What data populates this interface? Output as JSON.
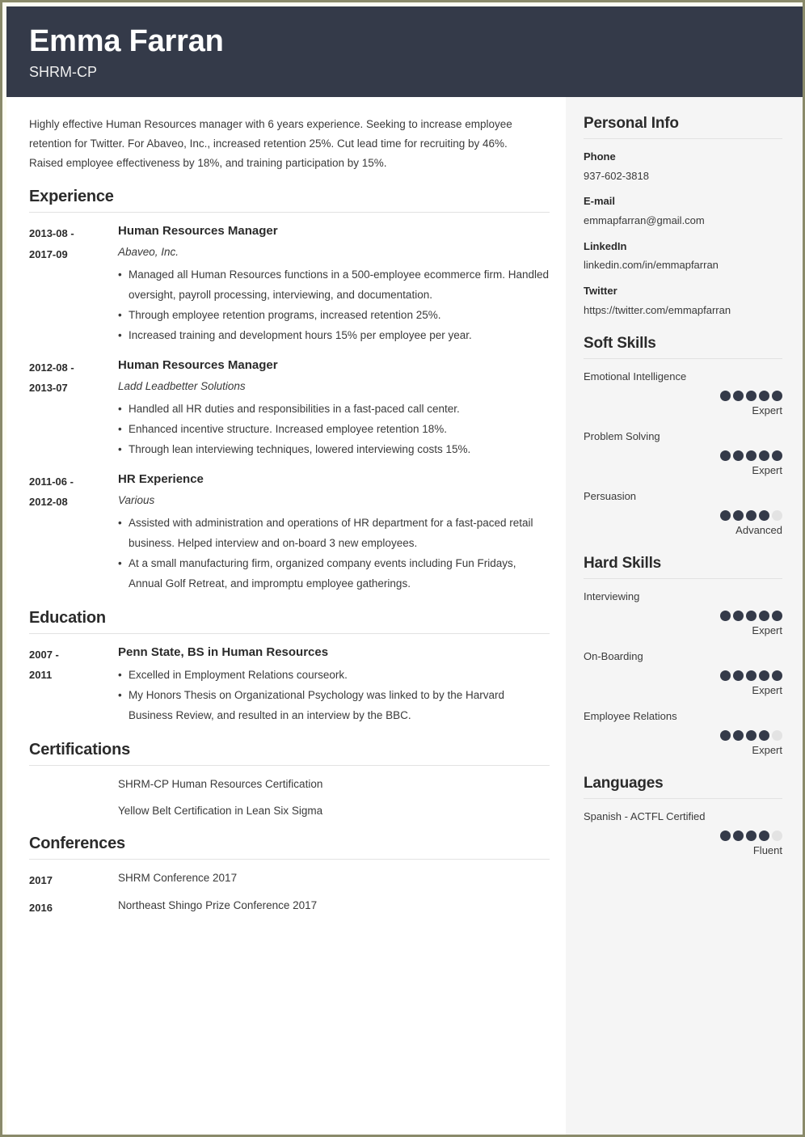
{
  "header": {
    "name": "Emma Farran",
    "credential": "SHRM-CP"
  },
  "main": {
    "summary": "Highly effective Human Resources manager with 6 years experience. Seeking to increase employee retention for Twitter. For Abaveo, Inc., increased retention 25%. Cut lead time for recruiting by 46%. Raised employee effectiveness by 18%, and training participation by 15%.",
    "sections": {
      "experience": {
        "title": "Experience",
        "entries": [
          {
            "date": "2013-08 - 2017-09",
            "date_line1": "2013-08 -",
            "date_line2": "2017-09",
            "title": "Human Resources Manager",
            "company": "Abaveo, Inc.",
            "bullets": [
              "Managed all Human Resources functions in a 500-employee ecommerce firm. Handled oversight, payroll processing, interviewing, and documentation.",
              "Through employee retention programs, increased retention 25%.",
              "Increased training and development hours 15% per employee per year."
            ]
          },
          {
            "date": "2012-08 - 2013-07",
            "date_line1": "2012-08 -",
            "date_line2": "2013-07",
            "title": "Human Resources Manager",
            "company": "Ladd Leadbetter Solutions",
            "bullets": [
              "Handled all HR duties and responsibilities in a fast-paced call center.",
              "Enhanced incentive structure. Increased employee retention 18%.",
              "Through lean interviewing techniques, lowered interviewing costs 15%."
            ]
          },
          {
            "date": "2011-06 - 2012-08",
            "date_line1": "2011-06 -",
            "date_line2": "2012-08",
            "title": "HR Experience",
            "company": "Various",
            "bullets": [
              "Assisted with administration and operations of HR department for a fast-paced retail business. Helped interview and on-board 3 new employees.",
              "At a small manufacturing firm, organized company events including Fun Fridays, Annual Golf Retreat, and impromptu employee gatherings."
            ]
          }
        ]
      },
      "education": {
        "title": "Education",
        "entries": [
          {
            "date": "2007 - 2011",
            "date_line1": "2007 -",
            "date_line2": "2011",
            "title": "Penn State, BS in Human Resources",
            "bullets": [
              "Excelled in Employment Relations courseork.",
              "My Honors Thesis on Organizational Psychology was linked to by the Harvard Business Review, and resulted in an interview by the BBC."
            ]
          }
        ]
      },
      "certifications": {
        "title": "Certifications",
        "items": [
          {
            "date": "",
            "text": "SHRM-CP Human Resources Certification"
          },
          {
            "date": "",
            "text": "Yellow Belt Certification in Lean Six Sigma"
          }
        ]
      },
      "conferences": {
        "title": "Conferences",
        "items": [
          {
            "date": "2017",
            "text": "SHRM Conference 2017"
          },
          {
            "date": "2016",
            "text": "Northeast Shingo Prize Conference 2017"
          }
        ]
      }
    }
  },
  "sidebar": {
    "personal_info": {
      "title": "Personal Info",
      "items": [
        {
          "label": "Phone",
          "value": "937-602-3818"
        },
        {
          "label": "E-mail",
          "value": "emmapfarran@gmail.com"
        },
        {
          "label": "LinkedIn",
          "value": "linkedin.com/in/emmapfarran"
        },
        {
          "label": "Twitter",
          "value": "https://twitter.com/emmapfarran"
        }
      ]
    },
    "soft_skills": {
      "title": "Soft Skills",
      "items": [
        {
          "name": "Emotional Intelligence",
          "rating": 5,
          "max": 5,
          "level": "Expert"
        },
        {
          "name": "Problem Solving",
          "rating": 5,
          "max": 5,
          "level": "Expert"
        },
        {
          "name": "Persuasion",
          "rating": 4,
          "max": 5,
          "level": "Advanced"
        }
      ]
    },
    "hard_skills": {
      "title": "Hard Skills",
      "items": [
        {
          "name": "Interviewing",
          "rating": 5,
          "max": 5,
          "level": "Expert"
        },
        {
          "name": "On-Boarding",
          "rating": 5,
          "max": 5,
          "level": "Expert"
        },
        {
          "name": "Employee Relations",
          "rating": 4,
          "max": 5,
          "level": "Expert"
        }
      ]
    },
    "languages": {
      "title": "Languages",
      "items": [
        {
          "name": "Spanish - ACTFL Certified",
          "rating": 4,
          "max": 5,
          "level": "Fluent"
        }
      ]
    }
  },
  "colors": {
    "header_bg": "#343a49",
    "sidebar_bg": "#f5f5f5",
    "dot_filled": "#343a49",
    "dot_empty": "#e3e3e3",
    "page_border": "#8a8a6a"
  }
}
